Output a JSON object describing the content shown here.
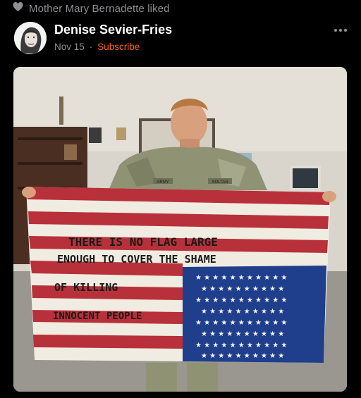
{
  "activity": {
    "liked_text": "Mother Mary Bernadette liked",
    "icon": "heart-icon"
  },
  "post": {
    "author": "Denise Sevier-Fries",
    "date": "Nov 15",
    "separator": "·",
    "subscribe_label": "Subscribe",
    "more_icon": "ellipsis-icon"
  },
  "photo": {
    "sign_lines": [
      "THERE IS NO FLAG LARGE",
      "ENOUGH TO COVER THE SHAME",
      "OF KILLING",
      "INNOCENT PEOPLE"
    ],
    "name_tape": "SOLTAN",
    "name_tape_2": "ARMY"
  },
  "colors": {
    "background": "#000000",
    "muted": "#8e8e93",
    "accent": "#ff6719",
    "flag_red": "#b8313a",
    "flag_blue": "#1f3f8c"
  }
}
